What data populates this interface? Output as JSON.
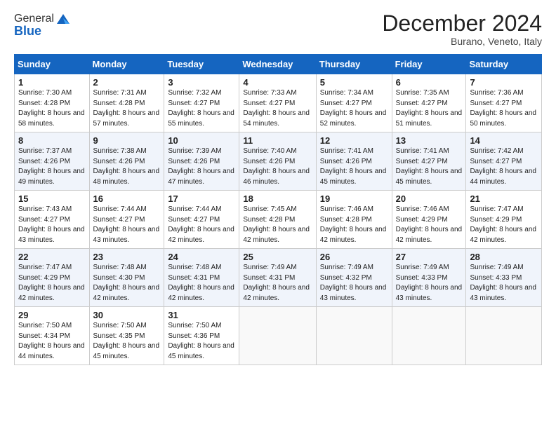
{
  "header": {
    "logo_general": "General",
    "logo_blue": "Blue",
    "month_title": "December 2024",
    "location": "Burano, Veneto, Italy"
  },
  "weekdays": [
    "Sunday",
    "Monday",
    "Tuesday",
    "Wednesday",
    "Thursday",
    "Friday",
    "Saturday"
  ],
  "rows": [
    [
      {
        "day": "1",
        "sunrise": "7:30 AM",
        "sunset": "4:28 PM",
        "daylight": "8 hours and 58 minutes."
      },
      {
        "day": "2",
        "sunrise": "7:31 AM",
        "sunset": "4:28 PM",
        "daylight": "8 hours and 57 minutes."
      },
      {
        "day": "3",
        "sunrise": "7:32 AM",
        "sunset": "4:27 PM",
        "daylight": "8 hours and 55 minutes."
      },
      {
        "day": "4",
        "sunrise": "7:33 AM",
        "sunset": "4:27 PM",
        "daylight": "8 hours and 54 minutes."
      },
      {
        "day": "5",
        "sunrise": "7:34 AM",
        "sunset": "4:27 PM",
        "daylight": "8 hours and 52 minutes."
      },
      {
        "day": "6",
        "sunrise": "7:35 AM",
        "sunset": "4:27 PM",
        "daylight": "8 hours and 51 minutes."
      },
      {
        "day": "7",
        "sunrise": "7:36 AM",
        "sunset": "4:27 PM",
        "daylight": "8 hours and 50 minutes."
      }
    ],
    [
      {
        "day": "8",
        "sunrise": "7:37 AM",
        "sunset": "4:26 PM",
        "daylight": "8 hours and 49 minutes."
      },
      {
        "day": "9",
        "sunrise": "7:38 AM",
        "sunset": "4:26 PM",
        "daylight": "8 hours and 48 minutes."
      },
      {
        "day": "10",
        "sunrise": "7:39 AM",
        "sunset": "4:26 PM",
        "daylight": "8 hours and 47 minutes."
      },
      {
        "day": "11",
        "sunrise": "7:40 AM",
        "sunset": "4:26 PM",
        "daylight": "8 hours and 46 minutes."
      },
      {
        "day": "12",
        "sunrise": "7:41 AM",
        "sunset": "4:26 PM",
        "daylight": "8 hours and 45 minutes."
      },
      {
        "day": "13",
        "sunrise": "7:41 AM",
        "sunset": "4:27 PM",
        "daylight": "8 hours and 45 minutes."
      },
      {
        "day": "14",
        "sunrise": "7:42 AM",
        "sunset": "4:27 PM",
        "daylight": "8 hours and 44 minutes."
      }
    ],
    [
      {
        "day": "15",
        "sunrise": "7:43 AM",
        "sunset": "4:27 PM",
        "daylight": "8 hours and 43 minutes."
      },
      {
        "day": "16",
        "sunrise": "7:44 AM",
        "sunset": "4:27 PM",
        "daylight": "8 hours and 43 minutes."
      },
      {
        "day": "17",
        "sunrise": "7:44 AM",
        "sunset": "4:27 PM",
        "daylight": "8 hours and 42 minutes."
      },
      {
        "day": "18",
        "sunrise": "7:45 AM",
        "sunset": "4:28 PM",
        "daylight": "8 hours and 42 minutes."
      },
      {
        "day": "19",
        "sunrise": "7:46 AM",
        "sunset": "4:28 PM",
        "daylight": "8 hours and 42 minutes."
      },
      {
        "day": "20",
        "sunrise": "7:46 AM",
        "sunset": "4:29 PM",
        "daylight": "8 hours and 42 minutes."
      },
      {
        "day": "21",
        "sunrise": "7:47 AM",
        "sunset": "4:29 PM",
        "daylight": "8 hours and 42 minutes."
      }
    ],
    [
      {
        "day": "22",
        "sunrise": "7:47 AM",
        "sunset": "4:29 PM",
        "daylight": "8 hours and 42 minutes."
      },
      {
        "day": "23",
        "sunrise": "7:48 AM",
        "sunset": "4:30 PM",
        "daylight": "8 hours and 42 minutes."
      },
      {
        "day": "24",
        "sunrise": "7:48 AM",
        "sunset": "4:31 PM",
        "daylight": "8 hours and 42 minutes."
      },
      {
        "day": "25",
        "sunrise": "7:49 AM",
        "sunset": "4:31 PM",
        "daylight": "8 hours and 42 minutes."
      },
      {
        "day": "26",
        "sunrise": "7:49 AM",
        "sunset": "4:32 PM",
        "daylight": "8 hours and 43 minutes."
      },
      {
        "day": "27",
        "sunrise": "7:49 AM",
        "sunset": "4:33 PM",
        "daylight": "8 hours and 43 minutes."
      },
      {
        "day": "28",
        "sunrise": "7:49 AM",
        "sunset": "4:33 PM",
        "daylight": "8 hours and 43 minutes."
      }
    ],
    [
      {
        "day": "29",
        "sunrise": "7:50 AM",
        "sunset": "4:34 PM",
        "daylight": "8 hours and 44 minutes."
      },
      {
        "day": "30",
        "sunrise": "7:50 AM",
        "sunset": "4:35 PM",
        "daylight": "8 hours and 45 minutes."
      },
      {
        "day": "31",
        "sunrise": "7:50 AM",
        "sunset": "4:36 PM",
        "daylight": "8 hours and 45 minutes."
      },
      null,
      null,
      null,
      null
    ]
  ],
  "labels": {
    "sunrise": "Sunrise:",
    "sunset": "Sunset:",
    "daylight": "Daylight:"
  }
}
